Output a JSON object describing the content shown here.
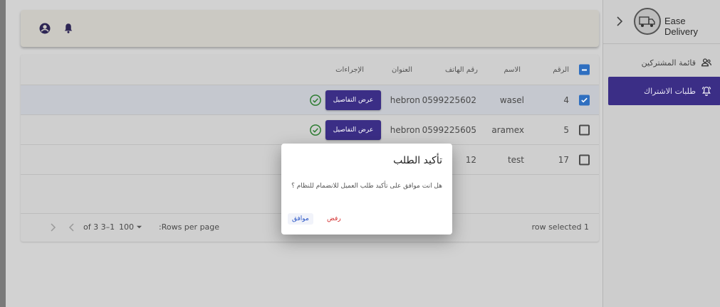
{
  "app": {
    "brand": "Ease Delivery"
  },
  "sidebar": {
    "items": [
      {
        "label": "قائمة المشتركين",
        "icon": "users-icon"
      },
      {
        "label": "طلبات الاشتراك",
        "icon": "bell-ring-icon"
      }
    ]
  },
  "topbar": {
    "icons": [
      "account-circle-icon",
      "bell-icon"
    ]
  },
  "table": {
    "headers": {
      "number": "الرقم",
      "name": "الاسم",
      "phone": "رقم الهاتف",
      "address": "العنوان",
      "actions": "الإجراءات"
    },
    "rows": [
      {
        "number": "4",
        "name": "wasel",
        "phone": "0599225602",
        "address": "hebron",
        "details": "عرض التفاصيل",
        "checked": true
      },
      {
        "number": "5",
        "name": "aramex",
        "phone": "0599225605",
        "address": "hebron",
        "details": "عرض التفاصيل",
        "checked": false
      },
      {
        "number": "17",
        "name": "test",
        "phone": "12",
        "address": "",
        "details": "",
        "checked": false
      }
    ],
    "footer": {
      "selected": "row selected 1",
      "rows_per_page_label": ":Rows per page",
      "rows_per_page_value": "100",
      "range": "of 3 3–1"
    }
  },
  "modal": {
    "title": "تأكيد الطلب",
    "message": "هل انت موافق على تأكيد طلب العميل للانضمام للنظام ؟",
    "cancel": "رفض",
    "confirm": "موافق"
  },
  "colors": {
    "primary": "#3b2e86",
    "check": "#2f6fc0",
    "success": "#2e7d32"
  }
}
